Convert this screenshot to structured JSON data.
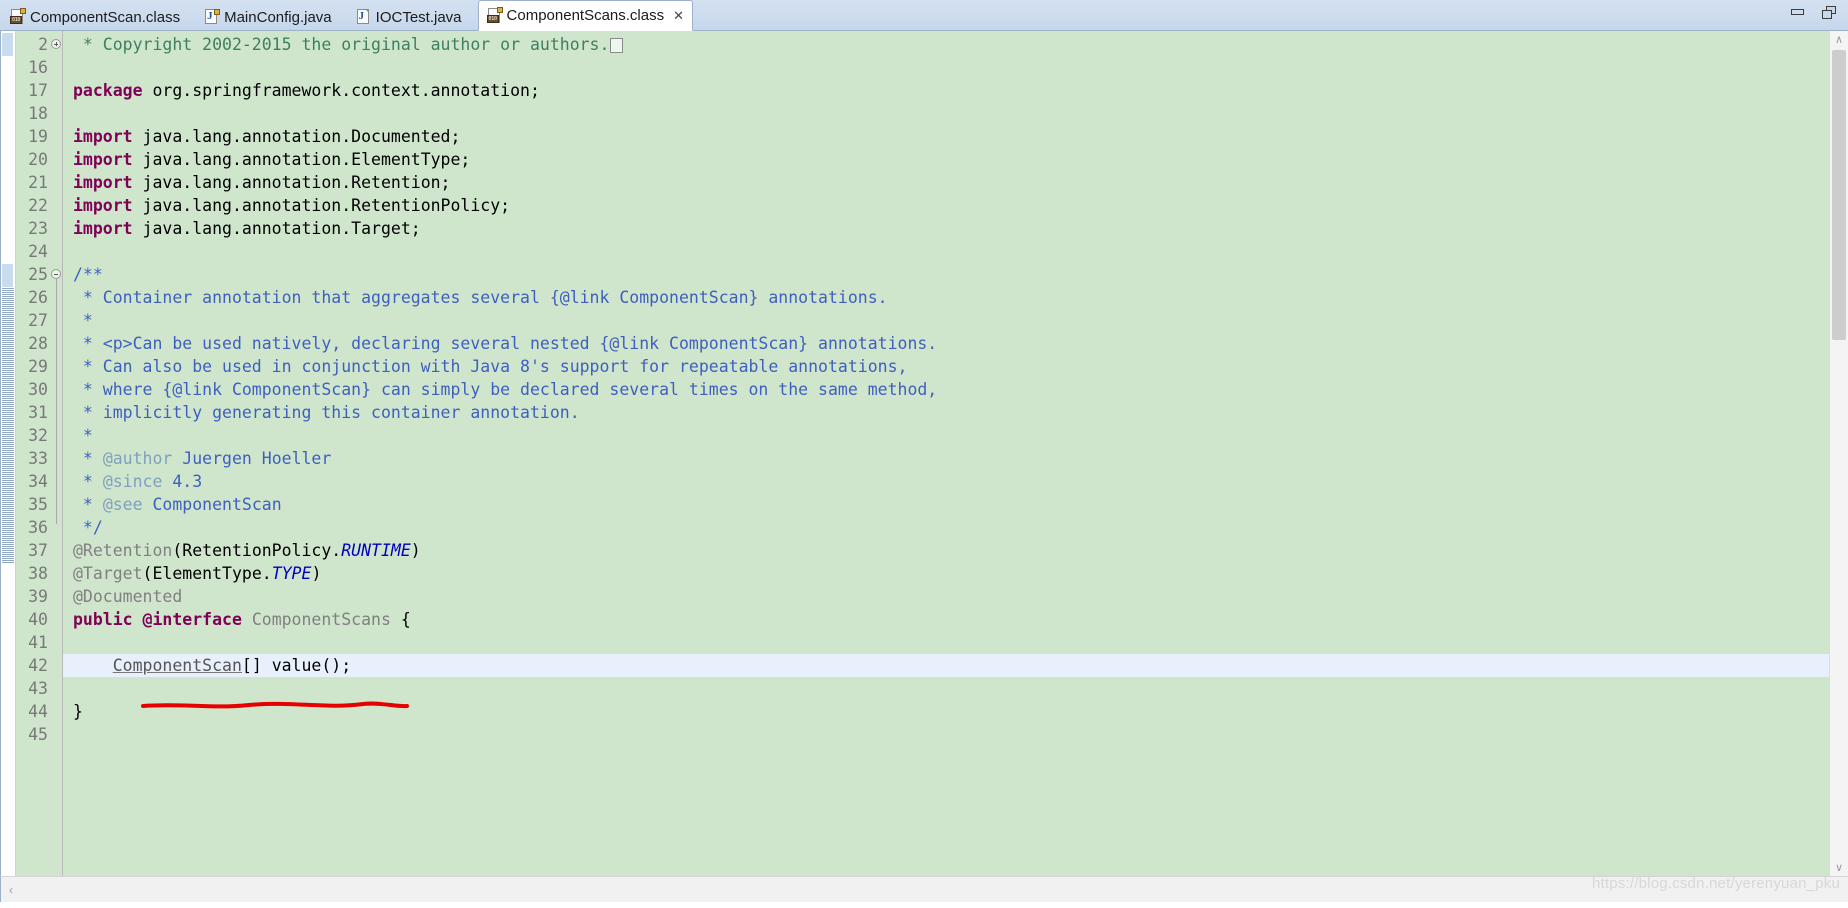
{
  "window": {
    "minimize_label": "Minimize",
    "maximize_label": "Maximize",
    "watermark": "https://blog.csdn.net/yerenyuan_pku"
  },
  "tabs": [
    {
      "label": "ComponentScan.class",
      "icon": "class-file-icon",
      "type": "cls",
      "active": false,
      "closable": false
    },
    {
      "label": "MainConfig.java",
      "icon": "java-file-icon",
      "type": "javac",
      "active": false,
      "closable": false
    },
    {
      "label": "IOCTest.java",
      "icon": "java-file-icon",
      "type": "java",
      "active": false,
      "closable": false
    },
    {
      "label": "ComponentScans.class",
      "icon": "class-file-icon",
      "type": "cls",
      "active": true,
      "closable": true,
      "close_label": "✕"
    }
  ],
  "editor": {
    "first_line_number": 2,
    "current_line": 42,
    "lines": [
      {
        "num": "2",
        "fold": "collapsed",
        "tokens": [
          {
            "t": "cmt",
            "v": " * Copyright 2002-2015 the original author or authors."
          },
          {
            "t": "foldbox",
            "v": ""
          }
        ]
      },
      {
        "num": "16",
        "tokens": []
      },
      {
        "num": "17",
        "tokens": [
          {
            "t": "kw",
            "v": "package"
          },
          {
            "t": "plain",
            "v": " org.springframework.context.annotation;"
          }
        ]
      },
      {
        "num": "18",
        "tokens": []
      },
      {
        "num": "19",
        "tokens": [
          {
            "t": "kw",
            "v": "import"
          },
          {
            "t": "plain",
            "v": " java.lang.annotation.Documented;"
          }
        ]
      },
      {
        "num": "20",
        "tokens": [
          {
            "t": "kw",
            "v": "import"
          },
          {
            "t": "plain",
            "v": " java.lang.annotation.ElementType;"
          }
        ]
      },
      {
        "num": "21",
        "tokens": [
          {
            "t": "kw",
            "v": "import"
          },
          {
            "t": "plain",
            "v": " java.lang.annotation.Retention;"
          }
        ]
      },
      {
        "num": "22",
        "tokens": [
          {
            "t": "kw",
            "v": "import"
          },
          {
            "t": "plain",
            "v": " java.lang.annotation.RetentionPolicy;"
          }
        ]
      },
      {
        "num": "23",
        "tokens": [
          {
            "t": "kw",
            "v": "import"
          },
          {
            "t": "plain",
            "v": " java.lang.annotation.Target;"
          }
        ]
      },
      {
        "num": "24",
        "tokens": []
      },
      {
        "num": "25",
        "fold": "expanded",
        "tokens": [
          {
            "t": "doc",
            "v": "/**"
          }
        ]
      },
      {
        "num": "26",
        "tokens": [
          {
            "t": "doc",
            "v": " * Container annotation that aggregates several {@link ComponentScan} annotations."
          }
        ]
      },
      {
        "num": "27",
        "tokens": [
          {
            "t": "doc",
            "v": " *"
          }
        ]
      },
      {
        "num": "28",
        "tokens": [
          {
            "t": "doc",
            "v": " * <p>Can be used natively, declaring several nested {@link ComponentScan} annotations."
          }
        ]
      },
      {
        "num": "29",
        "tokens": [
          {
            "t": "doc",
            "v": " * Can also be used in conjunction with Java 8's support for repeatable annotations,"
          }
        ]
      },
      {
        "num": "30",
        "tokens": [
          {
            "t": "doc",
            "v": " * where {@link ComponentScan} can simply be declared several times on the same method,"
          }
        ]
      },
      {
        "num": "31",
        "tokens": [
          {
            "t": "doc",
            "v": " * implicitly generating this container annotation."
          }
        ]
      },
      {
        "num": "32",
        "tokens": [
          {
            "t": "doc",
            "v": " *"
          }
        ]
      },
      {
        "num": "33",
        "tokens": [
          {
            "t": "doc",
            "v": " * "
          },
          {
            "t": "doctag",
            "v": "@author"
          },
          {
            "t": "doc",
            "v": " Juergen Hoeller"
          }
        ]
      },
      {
        "num": "34",
        "tokens": [
          {
            "t": "doc",
            "v": " * "
          },
          {
            "t": "doctag",
            "v": "@since"
          },
          {
            "t": "doc",
            "v": " 4.3"
          }
        ]
      },
      {
        "num": "35",
        "tokens": [
          {
            "t": "doc",
            "v": " * "
          },
          {
            "t": "doctag",
            "v": "@see"
          },
          {
            "t": "doc",
            "v": " ComponentScan"
          }
        ]
      },
      {
        "num": "36",
        "tokens": [
          {
            "t": "doc",
            "v": " */"
          }
        ]
      },
      {
        "num": "37",
        "tokens": [
          {
            "t": "anno",
            "v": "@Retention"
          },
          {
            "t": "plain",
            "v": "(RetentionPolicy."
          },
          {
            "t": "stat",
            "v": "RUNTIME"
          },
          {
            "t": "plain",
            "v": ")"
          }
        ]
      },
      {
        "num": "38",
        "tokens": [
          {
            "t": "anno",
            "v": "@Target"
          },
          {
            "t": "plain",
            "v": "(ElementType."
          },
          {
            "t": "stat",
            "v": "TYPE"
          },
          {
            "t": "plain",
            "v": ")"
          }
        ]
      },
      {
        "num": "39",
        "tokens": [
          {
            "t": "anno",
            "v": "@Documented"
          }
        ]
      },
      {
        "num": "40",
        "tokens": [
          {
            "t": "kw",
            "v": "public"
          },
          {
            "t": "plain",
            "v": " "
          },
          {
            "t": "kw",
            "v": "@interface"
          },
          {
            "t": "anno",
            "v": " ComponentScans "
          },
          {
            "t": "plain",
            "v": "{"
          }
        ]
      },
      {
        "num": "41",
        "tokens": []
      },
      {
        "num": "42",
        "current": true,
        "tokens": [
          {
            "t": "plain",
            "v": "    "
          },
          {
            "t": "undl",
            "v": "ComponentScan"
          },
          {
            "t": "plain",
            "v": "[] value();"
          }
        ]
      },
      {
        "num": "43",
        "tokens": []
      },
      {
        "num": "44",
        "tokens": [
          {
            "t": "plain",
            "v": "}"
          }
        ]
      },
      {
        "num": "45",
        "tokens": []
      }
    ],
    "annotation_red_underline": {
      "present": true,
      "color": "#e60000",
      "covers_text": "ComponentScan[] value();"
    }
  },
  "scrollbars": {
    "vertical_up": "∧",
    "vertical_down": "∨",
    "horizontal_left": "‹",
    "horizontal_right": "›"
  },
  "theme": {
    "editor_background": "#cfe6cd",
    "current_line_background": "#e8f0fb",
    "keyword_color": "#7f0055",
    "javadoc_color": "#3f5fbf",
    "javadoc_tag_color": "#7f9fbf",
    "annotation_color": "#808080",
    "static_field_color": "#0000c0",
    "tabbar_background": "#cddcee"
  }
}
